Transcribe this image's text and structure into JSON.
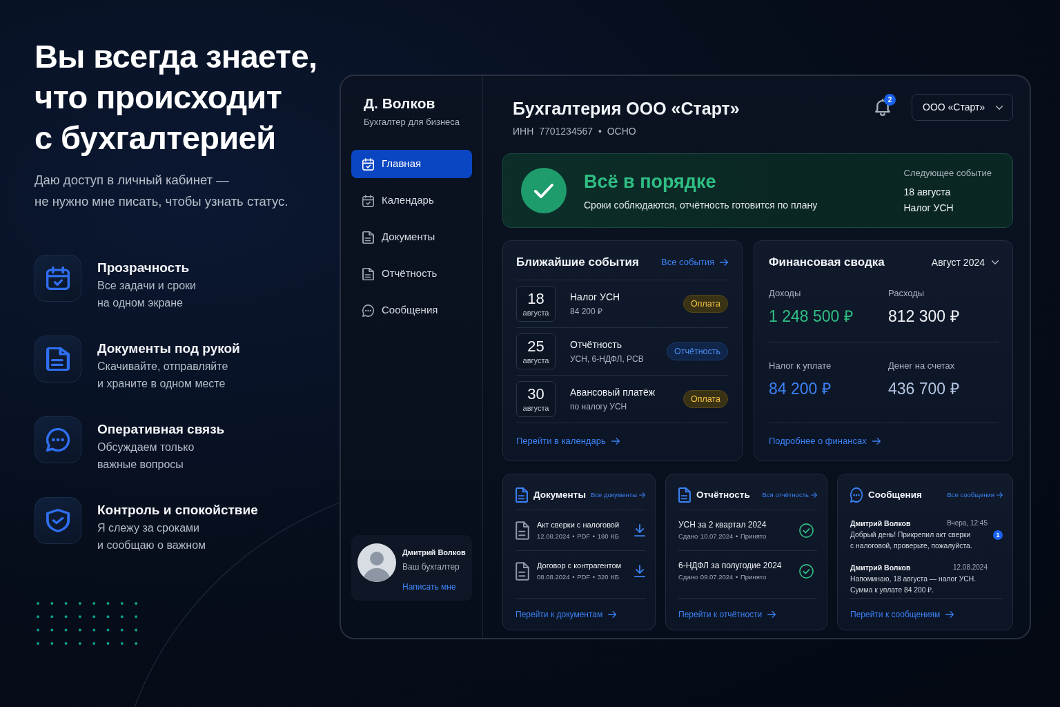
{
  "hero": {
    "title_lines": [
      "Вы всегда знаете,",
      "что происходит",
      "с бухгалтерией"
    ],
    "subtitle_lines": [
      "Даю доступ в личный кабинет —",
      "не нужно мне писать, чтобы узнать статус."
    ]
  },
  "features": [
    {
      "kind": "transparency",
      "title": "Прозрачность",
      "text_lines": [
        "Все задачи и сроки",
        "на одном экране"
      ]
    },
    {
      "kind": "documents",
      "title": "Документы под рукой",
      "text_lines": [
        "Скачивайте, отправляйте",
        "и храните в одном месте"
      ]
    },
    {
      "kind": "communication",
      "title": "Оперативная связь",
      "text_lines": [
        "Обсуждаем только",
        "важные вопросы"
      ]
    },
    {
      "kind": "control",
      "title": "Контроль и спокойствие",
      "text_lines": [
        "Я слежу за сроками",
        "и сообщаю о важном"
      ]
    }
  ],
  "sidebar": {
    "name": "Д. Волков",
    "role": "Бухгалтер для бизнеса",
    "items": [
      {
        "kind": "home",
        "label": "Главная",
        "selected": true
      },
      {
        "kind": "calendar",
        "label": "Календарь",
        "selected": false
      },
      {
        "kind": "documents",
        "label": "Документы",
        "selected": false
      },
      {
        "kind": "reports",
        "label": "Отчётность",
        "selected": false
      },
      {
        "kind": "messages",
        "label": "Сообщения",
        "selected": false
      }
    ],
    "accountant": {
      "name": "Дмитрий Волков",
      "role": "Ваш бухгалтер",
      "link": "Написать мне"
    }
  },
  "header": {
    "title": "Бухгалтерия ООО «Старт»",
    "details": "ИНН 7701234567 • ОСНО",
    "notifications": "2",
    "company": "ООО «Старт»"
  },
  "status": {
    "title": "Всё в порядке",
    "text": "Сроки соблюдаются, отчётность готовится по плану",
    "next_label": "Следующее событие",
    "next_date": "18 августа",
    "next_event": "Налог УСН"
  },
  "events": {
    "title": "Ближайшие события",
    "all_link": "Все события",
    "items": [
      {
        "day": "18",
        "month": "августа",
        "title": "Налог УСН",
        "subtitle": "84 200 ₽",
        "tag": {
          "text": "Оплата",
          "kind": "payment"
        }
      },
      {
        "day": "25",
        "month": "августа",
        "title": "Отчётность",
        "subtitle": "УСН, 6-НДФЛ, РСВ",
        "tag": {
          "text": "Отчётность",
          "kind": "report"
        }
      },
      {
        "day": "30",
        "month": "августа",
        "title": "Авансовый платёж",
        "subtitle": "по налогу УСН",
        "tag": {
          "text": "Оплата",
          "kind": "payment"
        }
      }
    ],
    "footer_link": "Перейти в календарь"
  },
  "finance": {
    "title": "Финансовая сводка",
    "period": "Август 2024",
    "metrics": [
      {
        "label": "Доходы",
        "value": "1 248 500 ₽",
        "color": "#2fbf84"
      },
      {
        "label": "Расходы",
        "value": "812 300 ₽",
        "color": "#f1f4f8"
      },
      {
        "label": "Налог к уплате",
        "value": "84 200 ₽",
        "color": "#3b82f6"
      },
      {
        "label": "Денег на счетах",
        "value": "436 700 ₽",
        "color": "#b4c6e4"
      }
    ],
    "footer_link": "Подробнее о финансах"
  },
  "documents": {
    "title": "Документы",
    "all_link": "Все документы",
    "items": [
      {
        "name": "Акт сверки с налоговой",
        "meta": "12.08.2024 • PDF • 180 КБ"
      },
      {
        "name": "Договор с контрагентом",
        "meta": "08.08.2024 • PDF • 320 КБ"
      }
    ],
    "footer_link": "Перейти к документам"
  },
  "reports": {
    "title": "Отчётность",
    "all_link": "Вся отчётность",
    "items": [
      {
        "name": "УСН за 2 квартал 2024",
        "meta": "Сдано 10.07.2024 • Принято"
      },
      {
        "name": "6-НДФЛ за полугодие 2024",
        "meta": "Сдано 09.07.2024 • Принято"
      }
    ],
    "footer_link": "Перейти к отчётности"
  },
  "messages": {
    "title": "Сообщения",
    "all_link": "Все сообщения",
    "items": [
      {
        "sender": "Дмитрий Волков",
        "time": "Вчера, 12:45",
        "text_lines": [
          "Добрый день! Прикрепил акт сверки",
          "с налоговой, проверьте, пожалуйста."
        ],
        "unread": "1"
      },
      {
        "sender": "Дмитрий Волков",
        "time": "12.08.2024",
        "text_lines": [
          "Напоминаю, 18 августа — налог УСН.",
          "Сумма к уплате 84 200 ₽."
        ]
      }
    ],
    "footer_link": "Перейти к сообщениям"
  }
}
